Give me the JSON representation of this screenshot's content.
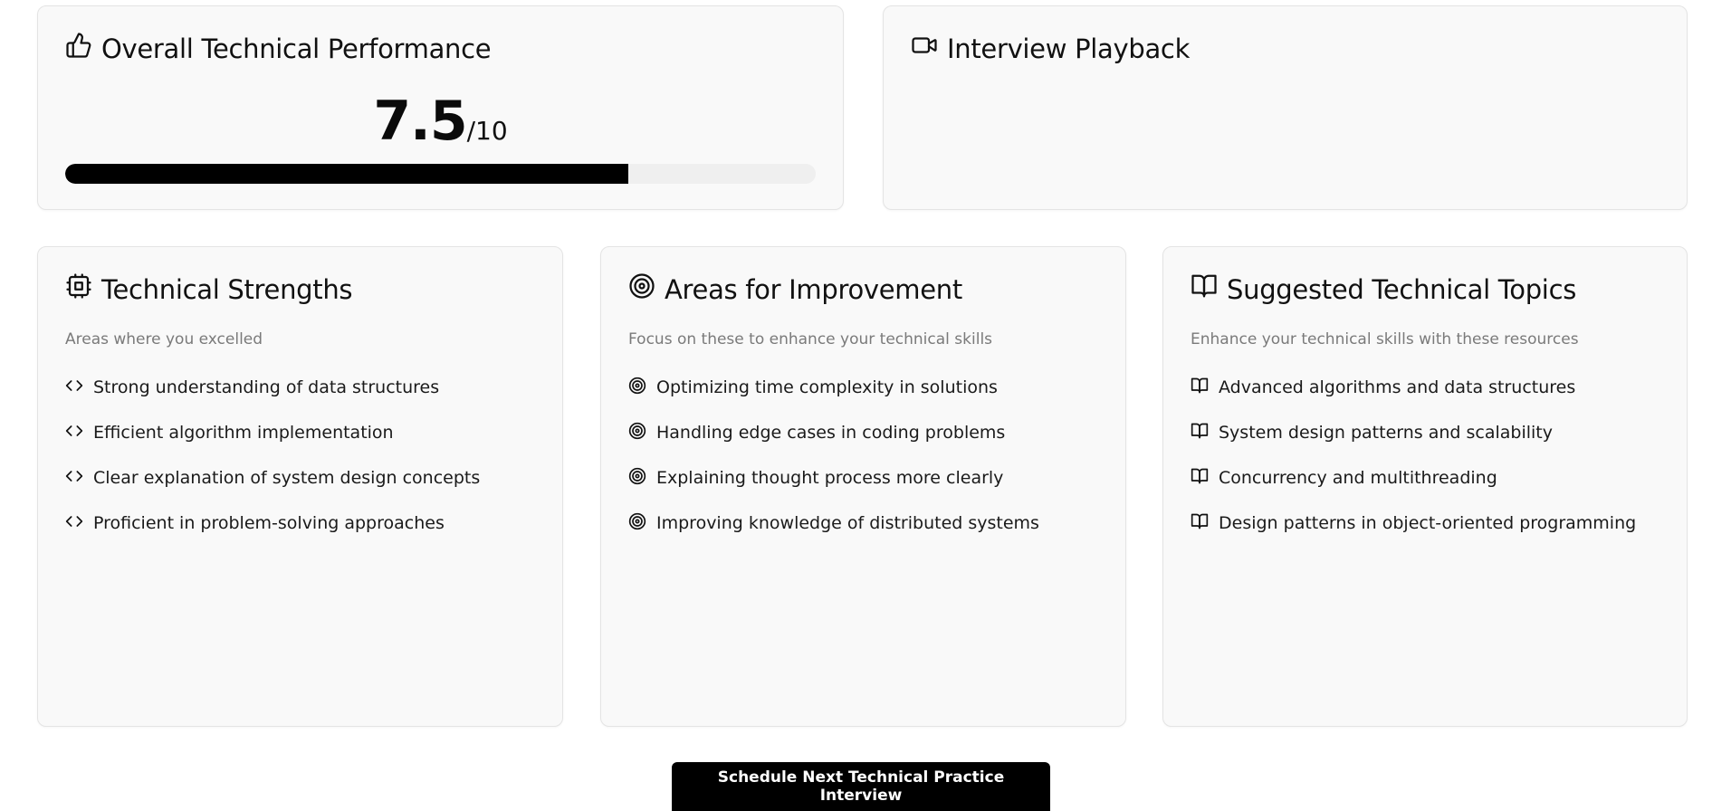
{
  "performance": {
    "title": "Overall Technical Performance",
    "score": "7.5",
    "max": "/10",
    "fraction": 0.75
  },
  "playback": {
    "title": "Interview Playback"
  },
  "strengths": {
    "title": "Technical Strengths",
    "subtitle": "Areas where you excelled",
    "icon": "cpu-icon",
    "item_icon": "code-icon",
    "items": [
      "Strong understanding of data structures",
      "Efficient algorithm implementation",
      "Clear explanation of system design concepts",
      "Proficient in problem-solving approaches"
    ]
  },
  "improvement": {
    "title": "Areas for Improvement",
    "subtitle": "Focus on these to enhance your technical skills",
    "icon": "target-icon",
    "item_icon": "target-icon",
    "items": [
      "Optimizing time complexity in solutions",
      "Handling edge cases in coding problems",
      "Explaining thought process more clearly",
      "Improving knowledge of distributed systems"
    ]
  },
  "topics": {
    "title": "Suggested Technical Topics",
    "subtitle": "Enhance your technical skills with these resources",
    "icon": "book-open-icon",
    "item_icon": "book-open-icon",
    "items": [
      "Advanced algorithms and data structures",
      "System design patterns and scalability",
      "Concurrency and multithreading",
      "Design patterns in object-oriented programming"
    ]
  },
  "cta": {
    "label": "Schedule Next Technical Practice Interview"
  },
  "colors": {
    "card_bg": "#f9f9f9",
    "card_border": "#e4e4e4",
    "accent": "#000000",
    "muted": "#7a7a7a",
    "track": "#efefef"
  }
}
